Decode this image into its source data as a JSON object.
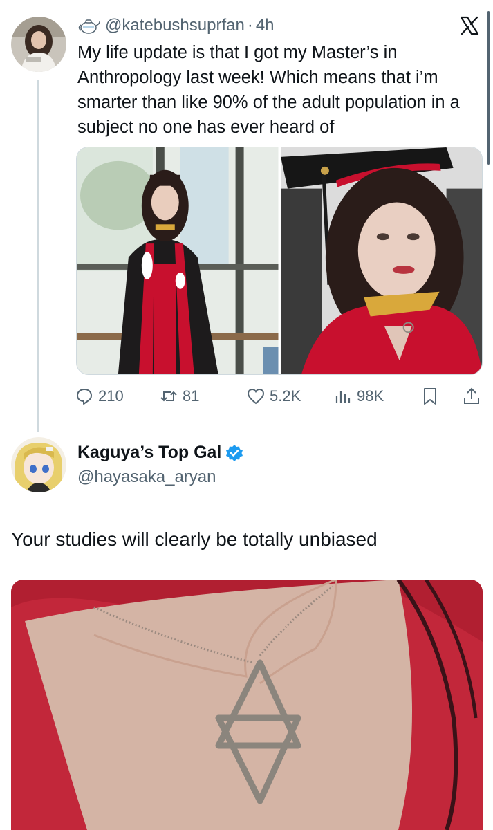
{
  "original_tweet": {
    "handle": "@katebushsuprfan",
    "separator": "·",
    "time": "4h",
    "text": "My life update is that I got my Master’s in Anthropology last week! Which means that i’m smarter than like 90% of the adult population in a subject no one has ever heard of",
    "actions": {
      "replies": "210",
      "retweets": "81",
      "likes": "5.2K",
      "views": "98K"
    }
  },
  "reply": {
    "display_name": "Kaguya’s Top Gal",
    "handle": "@hayasaka_aryan",
    "text": "Your studies will clearly be totally unbiased"
  },
  "icons": {
    "teapot": "teapot-icon",
    "x_logo": "x-logo-icon",
    "reply": "reply-icon",
    "retweet": "retweet-icon",
    "like": "heart-icon",
    "views": "views-icon",
    "bookmark": "bookmark-icon",
    "share": "share-icon",
    "verified": "verified-badge-icon"
  },
  "colors": {
    "text_primary": "#0f1419",
    "text_secondary": "#536471",
    "verified_blue": "#1d9bf0",
    "gown_red": "#c8102e"
  }
}
